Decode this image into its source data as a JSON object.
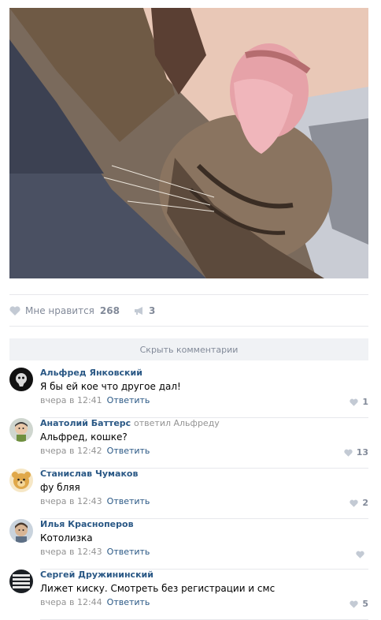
{
  "post": {
    "like_label": "Мне нравится",
    "like_count": "268",
    "share_count": "3",
    "hide_comments_label": "Скрыть комментарии",
    "photo_icon": "cat-photo"
  },
  "comments": [
    {
      "author": "Альфред Янковский",
      "reply_to": "",
      "text": "Я бы ей кое что другое дал!",
      "time": "вчера в 12:41",
      "reply_label": "Ответить",
      "likes": "1"
    },
    {
      "author": "Анатолий Баттерс",
      "reply_to": "ответил Альфреду",
      "text": "Альфред, кошке?",
      "time": "вчера в 12:42",
      "reply_label": "Ответить",
      "likes": "13"
    },
    {
      "author": "Станислав Чумаков",
      "reply_to": "",
      "text": "фу бляя",
      "time": "вчера в 12:43",
      "reply_label": "Ответить",
      "likes": "2"
    },
    {
      "author": "Илья Красноперов",
      "reply_to": "",
      "text": "Котолизка",
      "time": "вчера в 12:43",
      "reply_label": "Ответить",
      "likes": ""
    },
    {
      "author": "Сергей Дружининский",
      "reply_to": "",
      "text": "Лижет киску. Смотреть без регистрации и смс",
      "time": "вчера в 12:44",
      "reply_label": "Ответить",
      "likes": "5"
    }
  ],
  "colors": {
    "link": "#2a5885",
    "muted": "#828a99",
    "divider": "#e7e8ec"
  }
}
